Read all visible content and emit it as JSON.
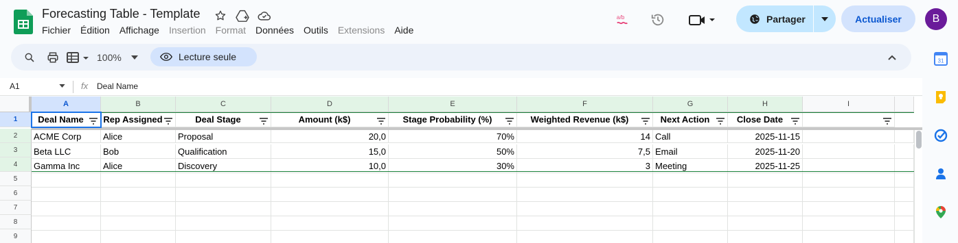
{
  "doc": {
    "title": "Forecasting Table - Template"
  },
  "menu": [
    {
      "label": "Fichier",
      "dim": false
    },
    {
      "label": "Édition",
      "dim": false
    },
    {
      "label": "Affichage",
      "dim": false
    },
    {
      "label": "Insertion",
      "dim": true
    },
    {
      "label": "Format",
      "dim": true
    },
    {
      "label": "Données",
      "dim": false
    },
    {
      "label": "Outils",
      "dim": false
    },
    {
      "label": "Extensions",
      "dim": true
    },
    {
      "label": "Aide",
      "dim": false
    }
  ],
  "actions": {
    "share_label": "Partager",
    "refresh_label": "Actualiser",
    "avatar_letter": "B"
  },
  "toolbar": {
    "zoom": "100%",
    "readonly_label": "Lecture seule"
  },
  "formula_bar": {
    "cell_ref": "A1",
    "fx": "fx",
    "content": "Deal Name"
  },
  "columns": [
    "A",
    "B",
    "C",
    "D",
    "E",
    "F",
    "G",
    "H",
    "I"
  ],
  "rows": [
    "1",
    "2",
    "3",
    "4",
    "5",
    "6",
    "7",
    "8",
    "9"
  ],
  "header_row": [
    "Deal Name",
    "Rep Assigned",
    "Deal Stage",
    "Amount (k$)",
    "Stage Probability (%)",
    "Weighted Revenue (k$)",
    "Next Action",
    "Close Date",
    ""
  ],
  "data_rows": [
    [
      "ACME Corp",
      "Alice",
      "Proposal",
      "20,0",
      "70%",
      "14",
      "Call",
      "2025-11-15",
      ""
    ],
    [
      "Beta LLC",
      "Bob",
      "Qualification",
      "15,0",
      "50%",
      "7,5",
      "Email",
      "2025-11-20",
      ""
    ],
    [
      "Gamma Inc",
      "Alice",
      "Discovery",
      "10,0",
      "30%",
      "3",
      "Meeting",
      "2025-11-25",
      ""
    ]
  ],
  "colors": {
    "accent": "#1a73e8",
    "share_bg": "#c2e7ff",
    "refresh_bg": "#d3e3fd",
    "table_green": "#188038",
    "header_green": "#e2f4e6",
    "avatar": "#6a1b9a"
  }
}
